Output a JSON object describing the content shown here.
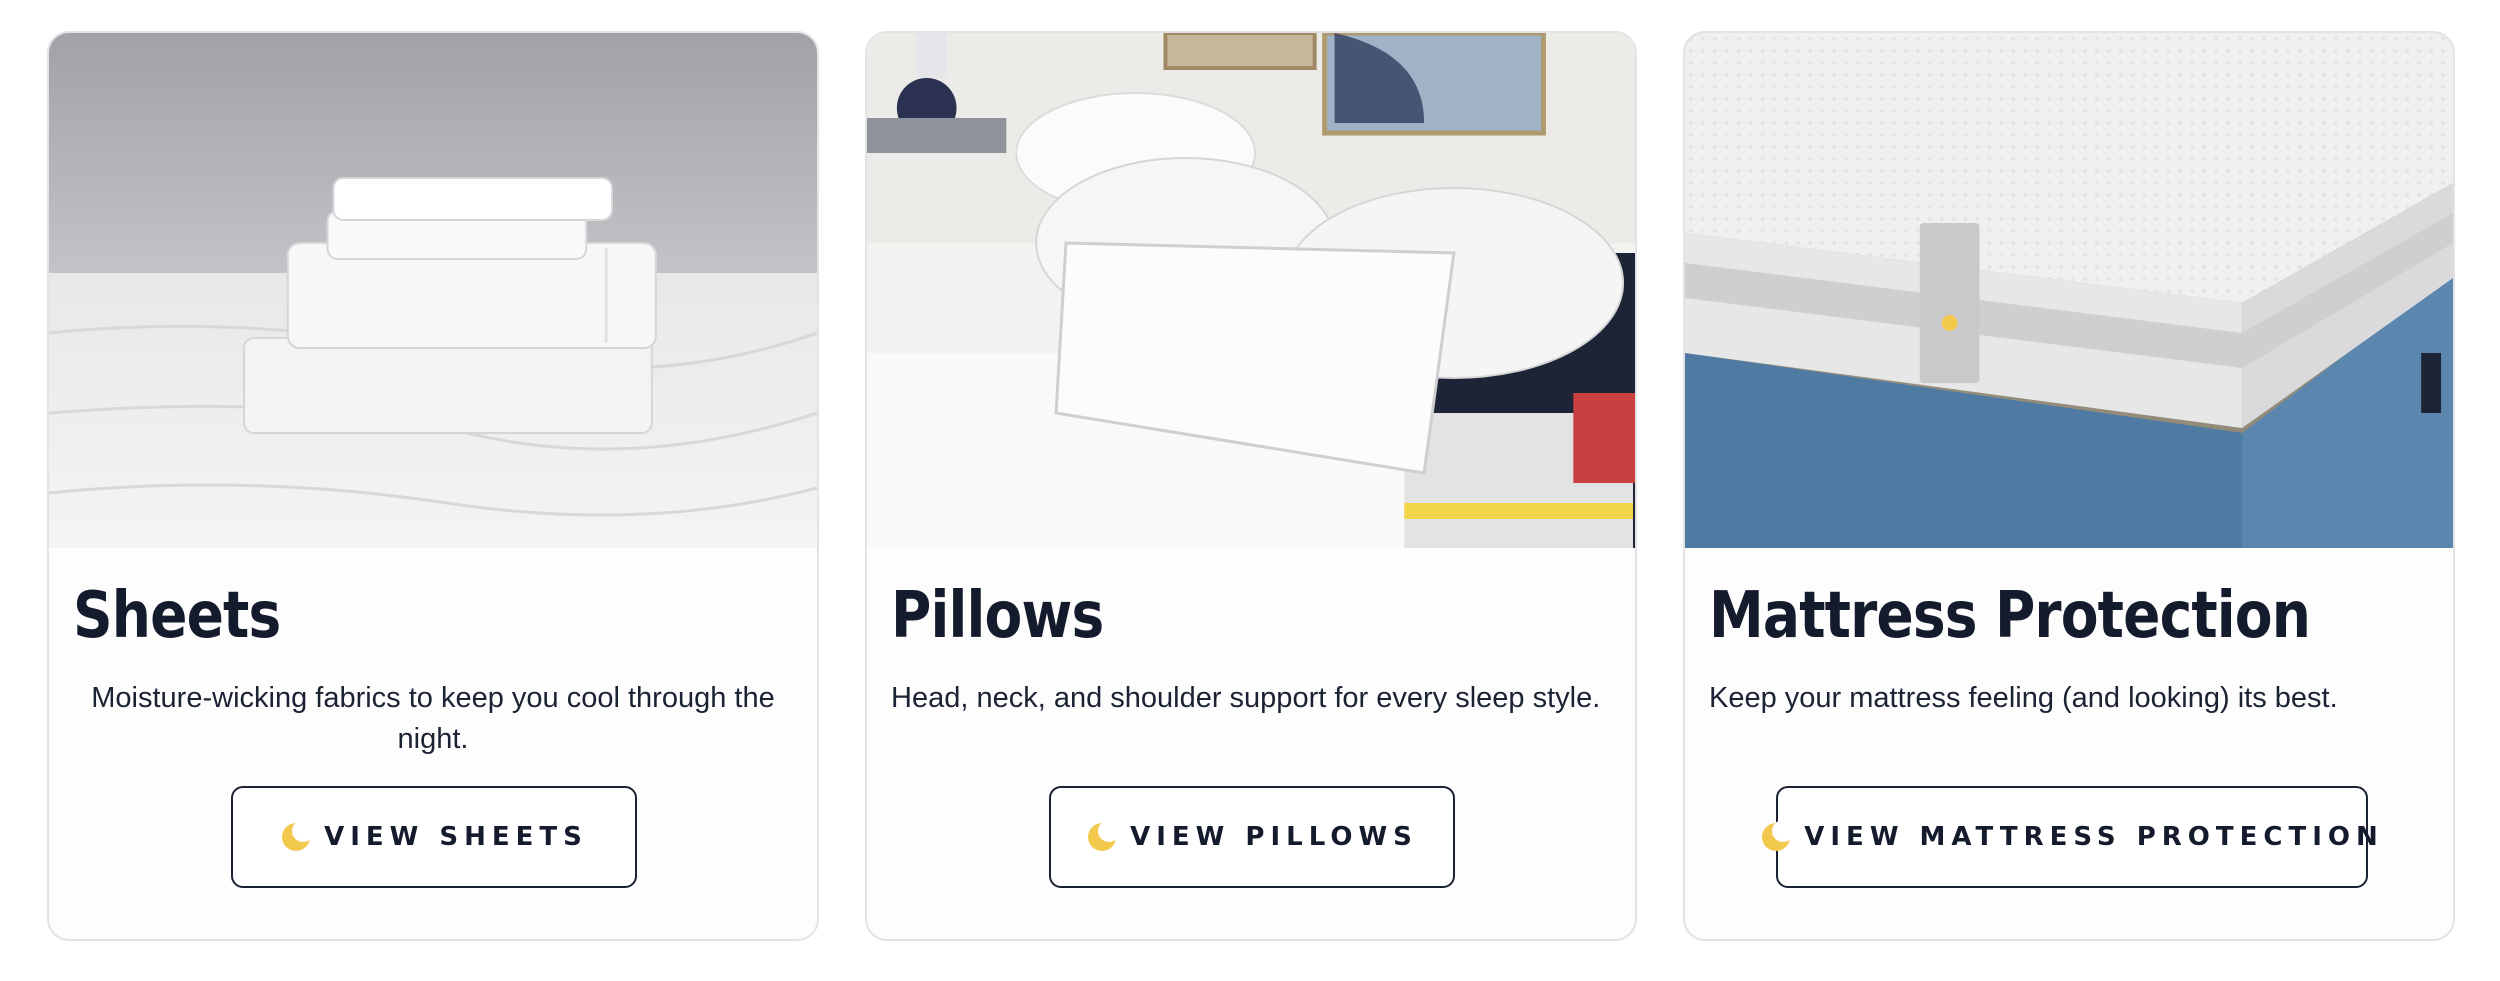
{
  "cards": [
    {
      "title": "Sheets",
      "description": "Moisture-wicking fabrics to keep you cool through the night.",
      "button_label": "VIEW SHEETS",
      "image": "folded-sheets-on-mattress",
      "button_icon": "moon-icon"
    },
    {
      "title": "Pillows",
      "description": "Head, neck, and shoulder support for every sleep style.",
      "button_label": "VIEW PILLOWS",
      "image": "pillows-on-bed",
      "button_icon": "moon-icon"
    },
    {
      "title": "Mattress Protection",
      "description": "Keep your mattress feeling (and looking) its best.",
      "button_label": "VIEW MATTRESS PROTECTION",
      "image": "mattress-protector-on-blue-bed",
      "button_icon": "moon-icon"
    }
  ],
  "colors": {
    "heading": "#141b2d",
    "moon": "#f2c94c",
    "card_border": "#e3e3e6"
  }
}
